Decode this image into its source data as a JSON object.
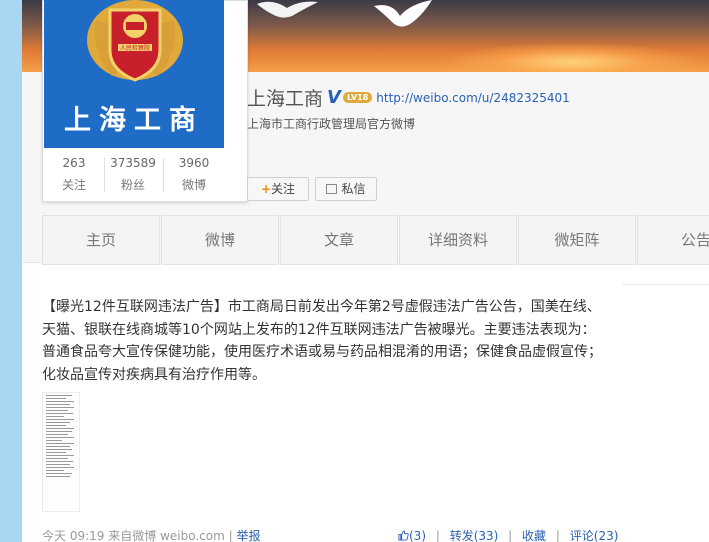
{
  "profile": {
    "avatar_text": "上海工商",
    "emblem_text": "人民检察院",
    "name": "上海工商",
    "verified_mark": "V",
    "level_badge": "LV18",
    "url": "http://weibo.com/u/2482325401",
    "bio": "上海市工商行政管理局官方微博"
  },
  "stats": [
    {
      "value": "263",
      "label": "关注"
    },
    {
      "value": "373589",
      "label": "粉丝"
    },
    {
      "value": "3960",
      "label": "微博"
    }
  ],
  "buttons": {
    "follow_plus": "+",
    "follow": "关注",
    "message": "私信"
  },
  "tabs": [
    "主页",
    "微博",
    "文章",
    "详细资料",
    "微矩阵",
    "公告"
  ],
  "post": {
    "text": "【曝光12件互联网违法广告】市工商局日前发出今年第2号虚假违法广告公告，国美在线、天猫、银联在线商城等10个网站上发布的12件互联网违法广告被曝光。主要违法表现为：普通食品夸大宣传保健功能，使用医疗术语或易与药品相混淆的用语；保健食品虚假宣传；化妆品宣传对疾病具有治疗作用等。"
  },
  "meta": {
    "time": "今天 09:19",
    "from_prefix": "来自",
    "source": "微博 weibo.com",
    "sep": "|",
    "report": "举报"
  },
  "actions": {
    "like": "(3)",
    "repost": "转发(33)",
    "favorite": "收藏",
    "comment": "评论(23)",
    "sep": "|"
  },
  "colors": {
    "link": "#2a61b4",
    "avatar_bg": "#1e6cc6",
    "follow_plus": "#f08a00"
  }
}
